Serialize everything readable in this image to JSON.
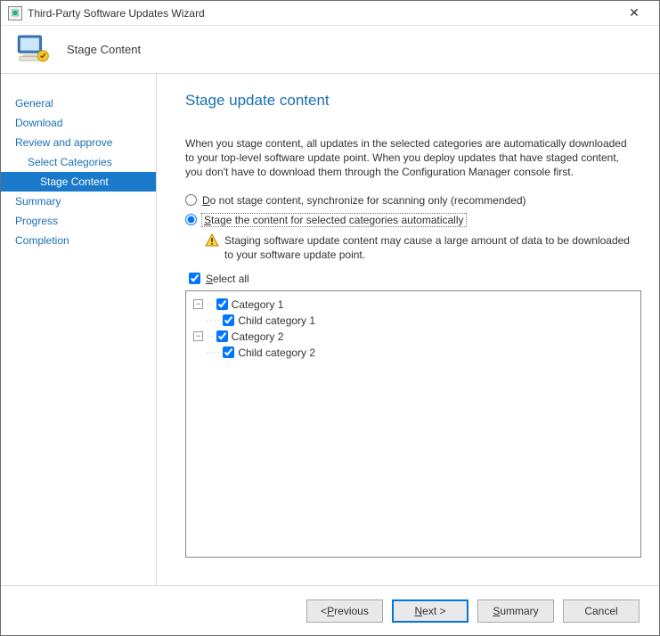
{
  "titlebar": {
    "title": "Third-Party Software Updates Wizard",
    "close_glyph": "✕"
  },
  "header": {
    "page_name": "Stage Content"
  },
  "sidebar": {
    "items": [
      {
        "label": "General",
        "indent": 0,
        "selected": false
      },
      {
        "label": "Download",
        "indent": 0,
        "selected": false
      },
      {
        "label": "Review and approve",
        "indent": 0,
        "selected": false
      },
      {
        "label": "Select Categories",
        "indent": 1,
        "selected": false
      },
      {
        "label": "Stage Content",
        "indent": 2,
        "selected": true
      },
      {
        "label": "Summary",
        "indent": 0,
        "selected": false
      },
      {
        "label": "Progress",
        "indent": 0,
        "selected": false
      },
      {
        "label": "Completion",
        "indent": 0,
        "selected": false
      }
    ]
  },
  "content": {
    "heading": "Stage update content",
    "description": "When you stage content, all updates in the selected categories are automatically downloaded to your top-level software update point. When you deploy updates that have staged content, you don't have to download them through the Configuration Manager console first.",
    "radio_do_not_stage_prefix": "D",
    "radio_do_not_stage_rest": "o not stage content, synchronize for scanning only (recommended)",
    "radio_stage_prefix": "S",
    "radio_stage_rest": "tage the content for selected categories automatically",
    "warning_text": "Staging software update content may cause a large amount of data to be downloaded to your software update point.",
    "select_all_prefix": "S",
    "select_all_rest": "elect all",
    "tree": {
      "nodes": [
        {
          "label": "Category 1",
          "depth": 0,
          "expander": "−",
          "checked": true
        },
        {
          "label": "Child category 1",
          "depth": 1,
          "expander": "",
          "checked": true
        },
        {
          "label": "Category 2",
          "depth": 0,
          "expander": "−",
          "checked": true
        },
        {
          "label": "Child category 2",
          "depth": 1,
          "expander": "",
          "checked": true
        }
      ]
    }
  },
  "footer": {
    "previous_prefix": "< ",
    "previous_under": "P",
    "previous_rest": "revious",
    "next_under": "N",
    "next_rest": "ext >",
    "summary_under": "S",
    "summary_rest": "ummary",
    "cancel": "Cancel"
  }
}
